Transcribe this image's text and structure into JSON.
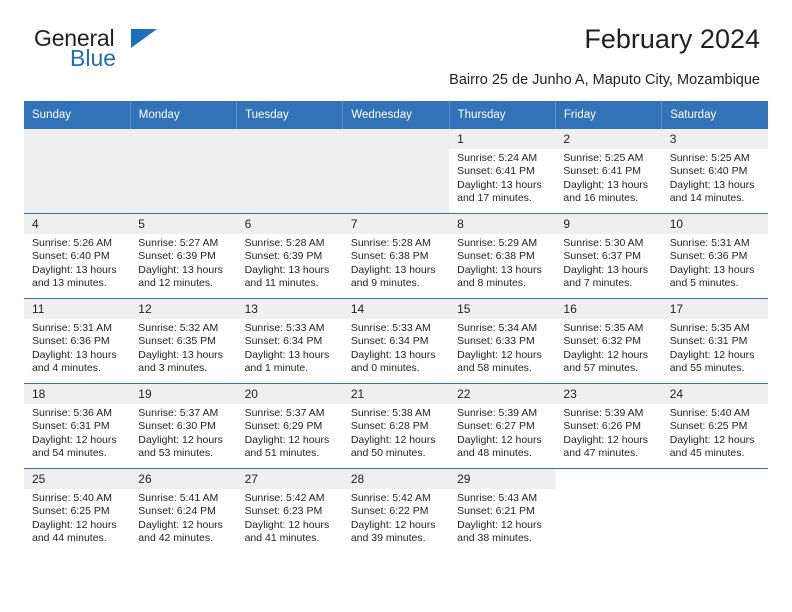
{
  "logo": {
    "word_one": "General",
    "word_two": "Blue",
    "triangle": "blue-triangle"
  },
  "header": {
    "title": "February 2024",
    "subtitle": "Bairro 25 de Junho A, Maputo City, Mozambique"
  },
  "colors": {
    "header_blue": "#3272b8",
    "logo_blue": "#1c6fba",
    "daynum_gray": "#efefef",
    "text": "#231f20"
  },
  "calendar": {
    "weekday_headers": [
      "Sunday",
      "Monday",
      "Tuesday",
      "Wednesday",
      "Thursday",
      "Friday",
      "Saturday"
    ],
    "weeks": [
      [
        {
          "empty": true
        },
        {
          "empty": true
        },
        {
          "empty": true
        },
        {
          "empty": true
        },
        {
          "day": "1",
          "sunrise": "Sunrise: 5:24 AM",
          "sunset": "Sunset: 6:41 PM",
          "daylight": "Daylight: 13 hours and 17 minutes."
        },
        {
          "day": "2",
          "sunrise": "Sunrise: 5:25 AM",
          "sunset": "Sunset: 6:41 PM",
          "daylight": "Daylight: 13 hours and 16 minutes."
        },
        {
          "day": "3",
          "sunrise": "Sunrise: 5:25 AM",
          "sunset": "Sunset: 6:40 PM",
          "daylight": "Daylight: 13 hours and 14 minutes."
        }
      ],
      [
        {
          "day": "4",
          "sunrise": "Sunrise: 5:26 AM",
          "sunset": "Sunset: 6:40 PM",
          "daylight": "Daylight: 13 hours and 13 minutes."
        },
        {
          "day": "5",
          "sunrise": "Sunrise: 5:27 AM",
          "sunset": "Sunset: 6:39 PM",
          "daylight": "Daylight: 13 hours and 12 minutes."
        },
        {
          "day": "6",
          "sunrise": "Sunrise: 5:28 AM",
          "sunset": "Sunset: 6:39 PM",
          "daylight": "Daylight: 13 hours and 11 minutes."
        },
        {
          "day": "7",
          "sunrise": "Sunrise: 5:28 AM",
          "sunset": "Sunset: 6:38 PM",
          "daylight": "Daylight: 13 hours and 9 minutes."
        },
        {
          "day": "8",
          "sunrise": "Sunrise: 5:29 AM",
          "sunset": "Sunset: 6:38 PM",
          "daylight": "Daylight: 13 hours and 8 minutes."
        },
        {
          "day": "9",
          "sunrise": "Sunrise: 5:30 AM",
          "sunset": "Sunset: 6:37 PM",
          "daylight": "Daylight: 13 hours and 7 minutes."
        },
        {
          "day": "10",
          "sunrise": "Sunrise: 5:31 AM",
          "sunset": "Sunset: 6:36 PM",
          "daylight": "Daylight: 13 hours and 5 minutes."
        }
      ],
      [
        {
          "day": "11",
          "sunrise": "Sunrise: 5:31 AM",
          "sunset": "Sunset: 6:36 PM",
          "daylight": "Daylight: 13 hours and 4 minutes."
        },
        {
          "day": "12",
          "sunrise": "Sunrise: 5:32 AM",
          "sunset": "Sunset: 6:35 PM",
          "daylight": "Daylight: 13 hours and 3 minutes."
        },
        {
          "day": "13",
          "sunrise": "Sunrise: 5:33 AM",
          "sunset": "Sunset: 6:34 PM",
          "daylight": "Daylight: 13 hours and 1 minute."
        },
        {
          "day": "14",
          "sunrise": "Sunrise: 5:33 AM",
          "sunset": "Sunset: 6:34 PM",
          "daylight": "Daylight: 13 hours and 0 minutes."
        },
        {
          "day": "15",
          "sunrise": "Sunrise: 5:34 AM",
          "sunset": "Sunset: 6:33 PM",
          "daylight": "Daylight: 12 hours and 58 minutes."
        },
        {
          "day": "16",
          "sunrise": "Sunrise: 5:35 AM",
          "sunset": "Sunset: 6:32 PM",
          "daylight": "Daylight: 12 hours and 57 minutes."
        },
        {
          "day": "17",
          "sunrise": "Sunrise: 5:35 AM",
          "sunset": "Sunset: 6:31 PM",
          "daylight": "Daylight: 12 hours and 55 minutes."
        }
      ],
      [
        {
          "day": "18",
          "sunrise": "Sunrise: 5:36 AM",
          "sunset": "Sunset: 6:31 PM",
          "daylight": "Daylight: 12 hours and 54 minutes."
        },
        {
          "day": "19",
          "sunrise": "Sunrise: 5:37 AM",
          "sunset": "Sunset: 6:30 PM",
          "daylight": "Daylight: 12 hours and 53 minutes."
        },
        {
          "day": "20",
          "sunrise": "Sunrise: 5:37 AM",
          "sunset": "Sunset: 6:29 PM",
          "daylight": "Daylight: 12 hours and 51 minutes."
        },
        {
          "day": "21",
          "sunrise": "Sunrise: 5:38 AM",
          "sunset": "Sunset: 6:28 PM",
          "daylight": "Daylight: 12 hours and 50 minutes."
        },
        {
          "day": "22",
          "sunrise": "Sunrise: 5:39 AM",
          "sunset": "Sunset: 6:27 PM",
          "daylight": "Daylight: 12 hours and 48 minutes."
        },
        {
          "day": "23",
          "sunrise": "Sunrise: 5:39 AM",
          "sunset": "Sunset: 6:26 PM",
          "daylight": "Daylight: 12 hours and 47 minutes."
        },
        {
          "day": "24",
          "sunrise": "Sunrise: 5:40 AM",
          "sunset": "Sunset: 6:25 PM",
          "daylight": "Daylight: 12 hours and 45 minutes."
        }
      ],
      [
        {
          "day": "25",
          "sunrise": "Sunrise: 5:40 AM",
          "sunset": "Sunset: 6:25 PM",
          "daylight": "Daylight: 12 hours and 44 minutes."
        },
        {
          "day": "26",
          "sunrise": "Sunrise: 5:41 AM",
          "sunset": "Sunset: 6:24 PM",
          "daylight": "Daylight: 12 hours and 42 minutes."
        },
        {
          "day": "27",
          "sunrise": "Sunrise: 5:42 AM",
          "sunset": "Sunset: 6:23 PM",
          "daylight": "Daylight: 12 hours and 41 minutes."
        },
        {
          "day": "28",
          "sunrise": "Sunrise: 5:42 AM",
          "sunset": "Sunset: 6:22 PM",
          "daylight": "Daylight: 12 hours and 39 minutes."
        },
        {
          "day": "29",
          "sunrise": "Sunrise: 5:43 AM",
          "sunset": "Sunset: 6:21 PM",
          "daylight": "Daylight: 12 hours and 38 minutes."
        },
        {
          "blank": true
        },
        {
          "blank": true
        }
      ]
    ]
  }
}
